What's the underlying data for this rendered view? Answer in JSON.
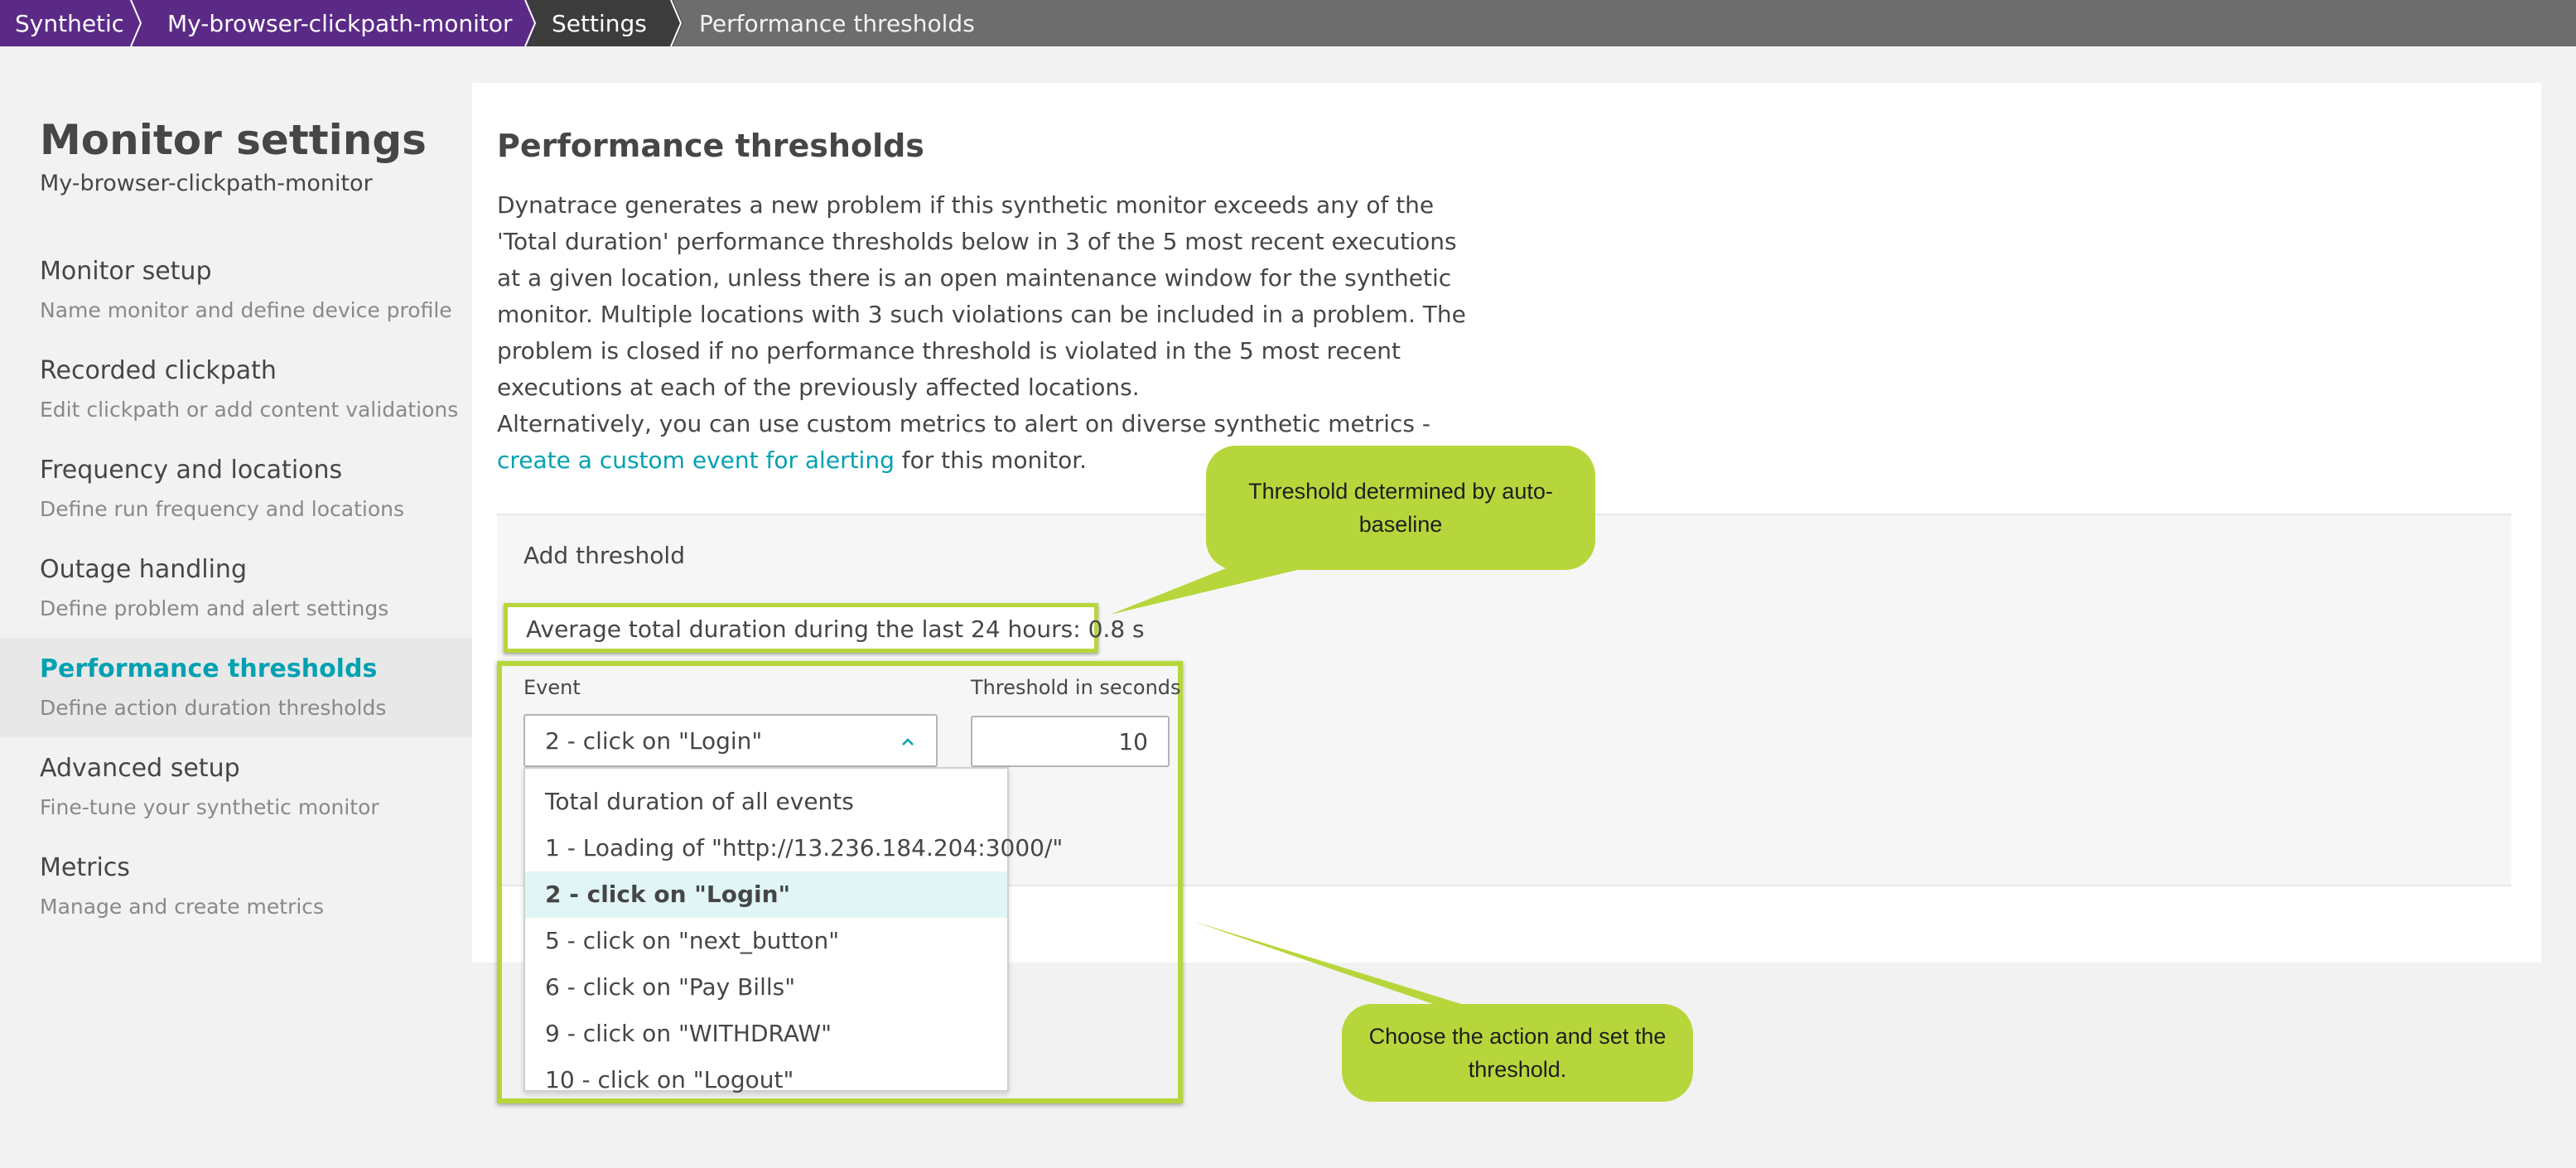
{
  "breadcrumb": {
    "items": [
      {
        "label": "Synthetic"
      },
      {
        "label": "My-browser-clickpath-monitor"
      },
      {
        "label": "Settings"
      },
      {
        "label": "Performance thresholds"
      }
    ]
  },
  "sidebar": {
    "title": "Monitor settings",
    "subtitle": "My-browser-clickpath-monitor",
    "items": [
      {
        "label": "Monitor setup",
        "desc": "Name monitor and define device profile"
      },
      {
        "label": "Recorded clickpath",
        "desc": "Edit clickpath or add content validations"
      },
      {
        "label": "Frequency and locations",
        "desc": "Define run frequency and locations"
      },
      {
        "label": "Outage handling",
        "desc": "Define problem and alert settings"
      },
      {
        "label": "Performance thresholds",
        "desc": "Define action duration thresholds",
        "active": true
      },
      {
        "label": "Advanced setup",
        "desc": "Fine-tune your synthetic monitor"
      },
      {
        "label": "Metrics",
        "desc": "Manage and create metrics"
      }
    ]
  },
  "main": {
    "title": "Performance thresholds",
    "description": "Dynatrace generates a new problem if this synthetic monitor exceeds any of the 'Total duration' performance thresholds below in 3 of the 5 most recent executions at a given location, unless there is an open maintenance window for the synthetic monitor. Multiple locations with 3 such violations can be included in a problem. The problem is closed if no performance threshold is violated in the 5 most recent executions at each of the previously affected locations.",
    "alt_prefix": "Alternatively, you can use custom metrics to alert on diverse synthetic metrics - ",
    "alt_link": "create a custom event for alerting",
    "alt_suffix": " for this monitor.",
    "add_threshold_label": "Add threshold",
    "average_text": "Average total duration during the last 24 hours: 0.8 s",
    "event_label": "Event",
    "threshold_label": "Threshold in seconds",
    "selected_event": "2 - click on \"Login\"",
    "threshold_value": "10",
    "dropdown_options": [
      "Total duration of all events",
      "1 - Loading of \"http://13.236.184.204:3000/\"",
      "2 - click on \"Login\"",
      "5 - click on \"next_button\"",
      "6 - click on \"Pay Bills\"",
      "9 - click on \"WITHDRAW\"",
      "10 - click on \"Logout\""
    ],
    "selected_index": 2
  },
  "callouts": {
    "auto_baseline": "Threshold determined by auto-baseline",
    "choose_action": "Choose the action and set the threshold."
  },
  "colors": {
    "brand_purple": "#5b2a86",
    "accent_teal": "#00a1b2",
    "annotation_green": "#b7d63b"
  }
}
